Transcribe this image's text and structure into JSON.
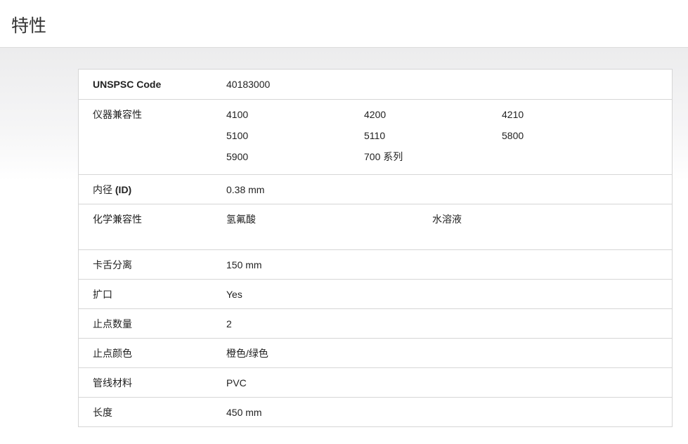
{
  "page": {
    "title": "特性"
  },
  "properties": {
    "unspsc": {
      "label": "UNSPSC Code",
      "value": "40183000"
    },
    "instrument_compat": {
      "label": "仪器兼容性",
      "values": [
        "4100",
        "4200",
        "4210",
        "5100",
        "5110",
        "5800",
        "5900",
        "700 系列"
      ]
    },
    "inner_diameter": {
      "label_prefix": "内径 ",
      "label_bold": "(ID)",
      "value": "0.38 mm"
    },
    "chem_compat": {
      "label": "化学兼容性",
      "values": [
        "氢氟酸",
        "水溶液"
      ]
    },
    "tab_separation": {
      "label": "卡舌分离",
      "value": "150 mm"
    },
    "flared": {
      "label": "扩口",
      "value": "Yes"
    },
    "stop_count": {
      "label": "止点数量",
      "value": "2"
    },
    "stop_color": {
      "label": "止点颜色",
      "value": "橙色/绿色"
    },
    "tubing_material": {
      "label": "管线材料",
      "value": "PVC"
    },
    "length": {
      "label": "长度",
      "value": "450 mm"
    }
  }
}
